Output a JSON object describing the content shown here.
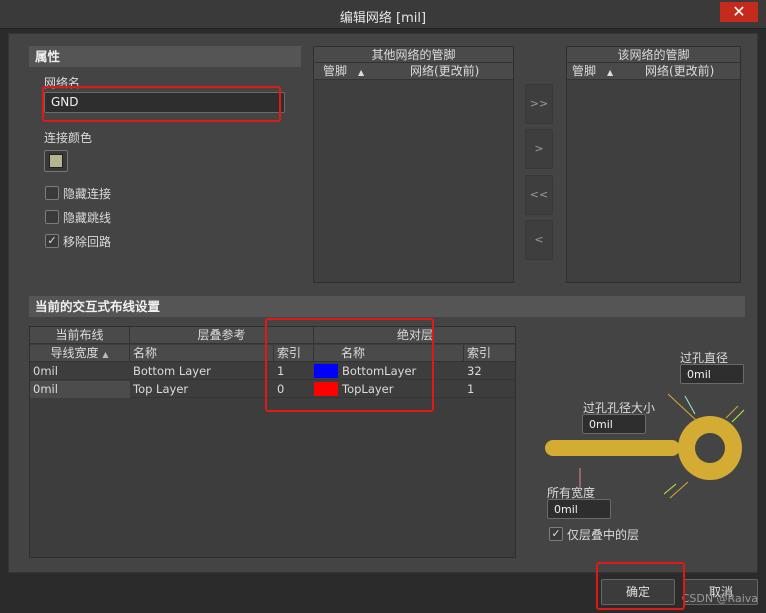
{
  "window": {
    "title": "编辑网络 [mil]",
    "close_glyph": "✕"
  },
  "properties": {
    "section_title": "属性",
    "net_name_label": "网络名",
    "net_name_value": "GND",
    "connection_color_label": "连接颜色",
    "connection_color": "#b7b391",
    "checkboxes": [
      {
        "label": "隐藏连接",
        "checked": false,
        "mark": ""
      },
      {
        "label": "隐藏跳线",
        "checked": false,
        "mark": ""
      },
      {
        "label": "移除回路",
        "checked": true,
        "mark": "✓"
      }
    ]
  },
  "other_pins": {
    "title": "其他网络的管脚",
    "col_pin": "管脚",
    "col_net": "网络(更改前)"
  },
  "this_pins": {
    "title": "该网络的管脚",
    "col_pin": "管脚",
    "col_net": "网络(更改前)"
  },
  "transfer_buttons": [
    ">>",
    ">",
    "<<",
    "<"
  ],
  "routing": {
    "section_title": "当前的交互式布线设置",
    "group_headers": {
      "current": "当前布线",
      "stack_ref": "层叠参考",
      "absolute": "绝对层"
    },
    "columns": {
      "trace_width": "导线宽度",
      "name": "名称",
      "index": "索引",
      "abs_name": "名称",
      "abs_index": "索引"
    },
    "rows": [
      {
        "width": "0mil",
        "name": "Bottom Layer",
        "index": "1",
        "color": "#0000ff",
        "abs_name": "BottomLayer",
        "abs_index": "32"
      },
      {
        "width": "0mil",
        "name": "Top Layer",
        "index": "0",
        "color": "#ff0000",
        "abs_name": "TopLayer",
        "abs_index": "1"
      }
    ]
  },
  "via": {
    "diameter_label": "过孔直径",
    "diameter_value": "0mil",
    "hole_label": "过孔孔径大小",
    "hole_value": "0mil",
    "width_label": "所有宽度",
    "width_value": "0mil",
    "stack_only_label": "仅层叠中的层",
    "stack_only_mark": "✓",
    "graphic_color": "#d4ac34"
  },
  "buttons": {
    "ok": "确定",
    "cancel": "取消"
  },
  "watermark": "CSDN @Raiva"
}
